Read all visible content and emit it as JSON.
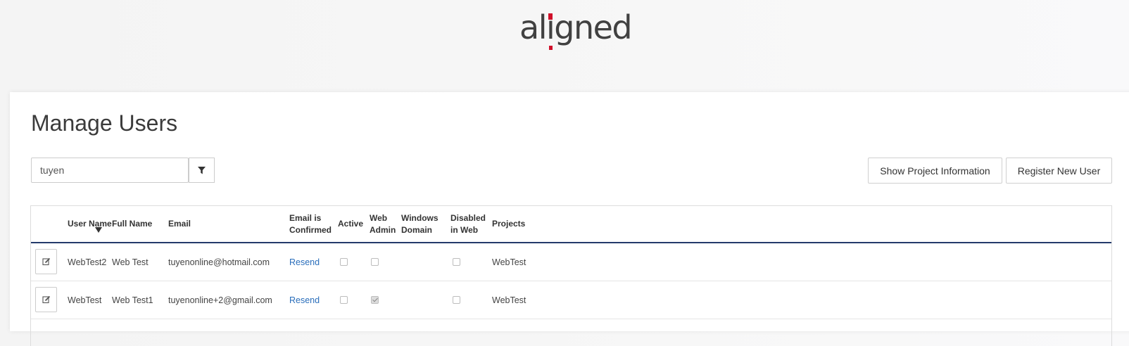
{
  "brand": {
    "logo_parts": [
      "al",
      "ı",
      "gned"
    ],
    "accent": "#d0102a"
  },
  "page": {
    "title": "Manage Users"
  },
  "search": {
    "value": "tuyen",
    "filter_icon": "filter-icon"
  },
  "toolbar": {
    "show_project_info": "Show Project Information",
    "register_new_user": "Register New User"
  },
  "table": {
    "headers": {
      "user_name": "User Name",
      "full_name": "Full Name",
      "email": "Email",
      "email_confirmed": "Email is Confirmed",
      "active": "Active",
      "web_admin": "Web Admin",
      "windows_domain": "Windows Domain",
      "disabled_in_web": "Disabled in Web",
      "projects": "Projects"
    },
    "sort": {
      "column": "user_name",
      "direction": "descending"
    },
    "rows": [
      {
        "user_name": "WebTest2",
        "full_name": "Web Test",
        "email": "tuyenonline@hotmail.com",
        "email_confirmed": "Resend",
        "active": false,
        "web_admin": false,
        "windows_domain": "",
        "disabled_in_web": false,
        "projects": "WebTest"
      },
      {
        "user_name": "WebTest",
        "full_name": "Web Test1",
        "email": "tuyenonline+2@gmail.com",
        "email_confirmed": "Resend",
        "active": false,
        "web_admin": true,
        "windows_domain": "",
        "disabled_in_web": false,
        "projects": "WebTest"
      }
    ]
  },
  "colors": {
    "header_rule": "#243a6b",
    "link": "#2a6ebb"
  }
}
